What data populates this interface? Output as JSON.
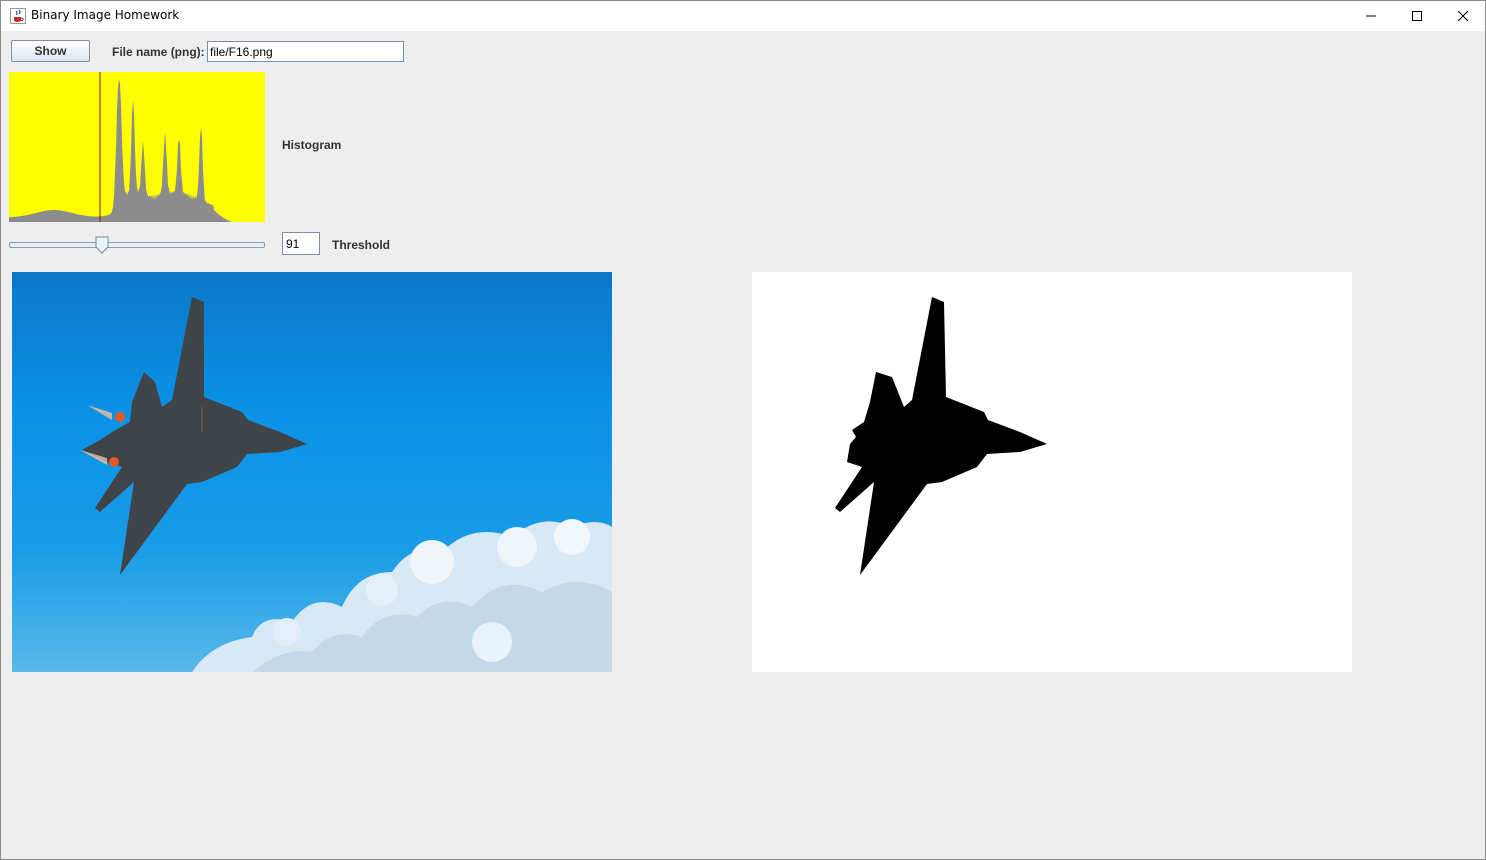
{
  "window": {
    "title": "Binary Image Homework",
    "app_icon": "java-cup-icon"
  },
  "toolbar": {
    "show_label": "Show",
    "file_label": "File name (png):",
    "file_value": "file/F16.png"
  },
  "histogram": {
    "label": "Histogram",
    "background_color": "#ffff00",
    "bar_color": "#8c8c8c",
    "marker_color": "#8b1a1a",
    "chart_data": {
      "type": "area",
      "x_range": [
        0,
        255
      ],
      "threshold_marker": 91,
      "peaks": [
        {
          "x": 110,
          "level": 0.88
        },
        {
          "x": 124,
          "level": 0.62
        },
        {
          "x": 134,
          "level": 0.35
        },
        {
          "x": 156,
          "level": 0.4
        },
        {
          "x": 170,
          "level": 0.38
        },
        {
          "x": 192,
          "level": 0.5
        }
      ]
    }
  },
  "threshold": {
    "label": "Threshold",
    "value": "91",
    "max": 255
  },
  "images": {
    "original": {
      "sky_top": "#0b78c8",
      "sky_mid": "#169ce8",
      "sky_bottom": "#4fb3ea",
      "cloud_color": "#e8f2fb",
      "jet_color": "#3f4449"
    },
    "binary": {
      "background": "#ffffff",
      "silhouette": "#000000"
    }
  }
}
